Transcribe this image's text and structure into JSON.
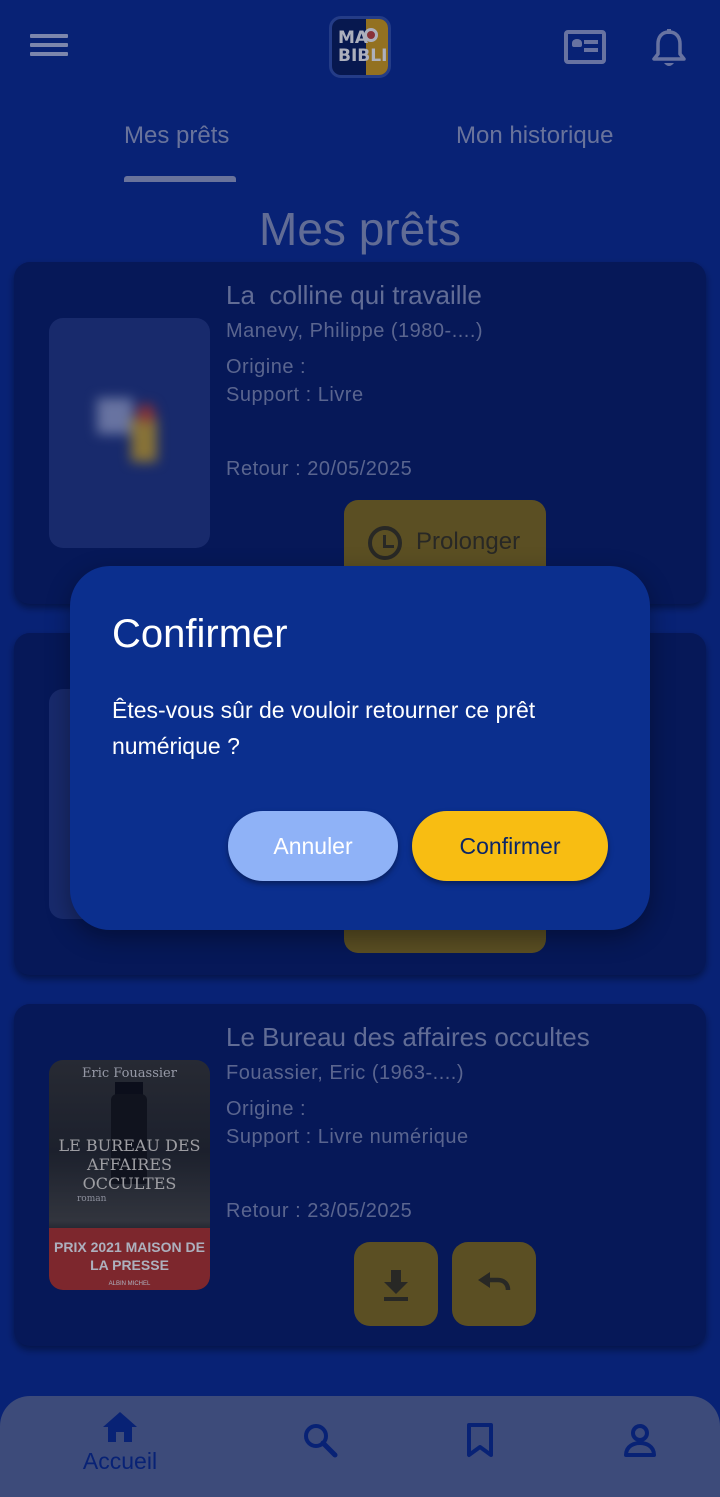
{
  "header": {
    "logo_text": "MA BIBLI",
    "menu_icon": "menu-icon",
    "card_icon": "id-card-icon",
    "bell_icon": "bell-icon"
  },
  "tabs": [
    {
      "label": "Mes prêts",
      "active": true
    },
    {
      "label": "Mon historique",
      "active": false
    }
  ],
  "page_title": "Mes prêts",
  "loans": [
    {
      "title": "La  colline qui travaille",
      "author": "Manevy, Philippe (1980-....)",
      "origin": "Origine :",
      "support": "Support : Livre",
      "return": "Retour : 20/05/2025",
      "action_label": "Prolonger"
    },
    {
      "title": "Le Bureau des affaires occultes",
      "author": "Fouassier, Eric (1963-....)",
      "origin": "Origine :",
      "support": "Support : Livre numérique",
      "return": "Retour : 23/05/2025",
      "cover": {
        "author": "Eric Fouassier",
        "title": "LE BUREAU DES AFFAIRES OCCULTES",
        "genre": "roman",
        "prize": "PRIX 2021 MAISON DE LA PRESSE",
        "publisher": "ALBIN MICHEL"
      }
    }
  ],
  "dialog": {
    "title": "Confirmer",
    "message": "Êtes-vous sûr de vouloir retourner ce prêt numérique ?",
    "cancel_label": "Annuler",
    "confirm_label": "Confirmer"
  },
  "bottom_nav": [
    {
      "label": "Accueil",
      "icon": "home-icon",
      "active": true
    },
    {
      "label": "",
      "icon": "search-icon"
    },
    {
      "label": "",
      "icon": "bookmark-icon"
    },
    {
      "label": "",
      "icon": "account-icon"
    }
  ],
  "colors": {
    "background": "#0d2f96",
    "dialog": "#0b2f8e",
    "confirm": "#f8bd12",
    "cancel": "#8fb2f7"
  }
}
